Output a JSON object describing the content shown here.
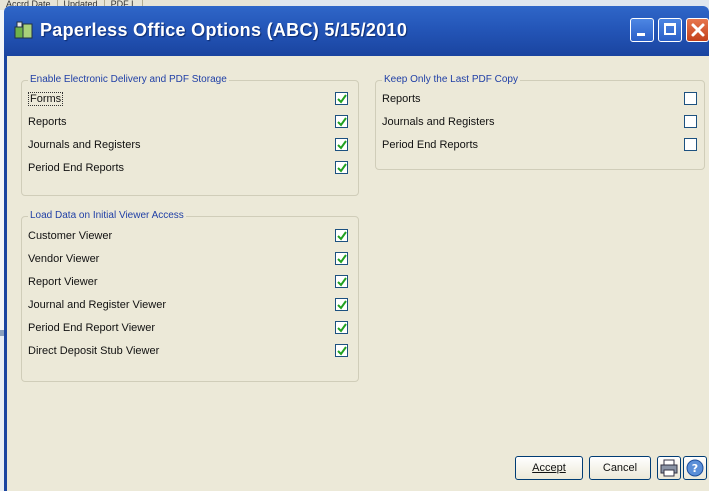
{
  "background": {
    "columns": [
      "Accrd Date",
      "Updated",
      "PDF L"
    ]
  },
  "window": {
    "title": "Paperless Office Options (ABC) 5/15/2010"
  },
  "groups": {
    "electronic": {
      "title": "Enable Electronic Delivery and PDF Storage",
      "items": [
        {
          "label": "Forms",
          "checked": true
        },
        {
          "label": "Reports",
          "checked": true
        },
        {
          "label": "Journals and Registers",
          "checked": true
        },
        {
          "label": "Period End Reports",
          "checked": true
        }
      ]
    },
    "viewer": {
      "title": "Load Data on Initial Viewer Access",
      "items": [
        {
          "label": "Customer Viewer",
          "checked": true
        },
        {
          "label": "Vendor Viewer",
          "checked": true
        },
        {
          "label": "Report Viewer",
          "checked": true
        },
        {
          "label": "Journal and Register Viewer",
          "checked": true
        },
        {
          "label": "Period End Report Viewer",
          "checked": true
        },
        {
          "label": "Direct Deposit Stub Viewer",
          "checked": true
        }
      ]
    },
    "keep": {
      "title": "Keep Only the Last PDF Copy",
      "items": [
        {
          "label": "Reports",
          "checked": false
        },
        {
          "label": "Journals and Registers",
          "checked": false
        },
        {
          "label": "Period End Reports",
          "checked": false
        }
      ]
    }
  },
  "buttons": {
    "accept": "Accept",
    "cancel": "Cancel",
    "print_icon": "printer-icon",
    "help_icon": "help-icon"
  },
  "colors": {
    "title_bar": "#2456b8",
    "dialog_bg": "#ece9d8",
    "group_title": "#1f3fa6",
    "check": "#21a121"
  }
}
